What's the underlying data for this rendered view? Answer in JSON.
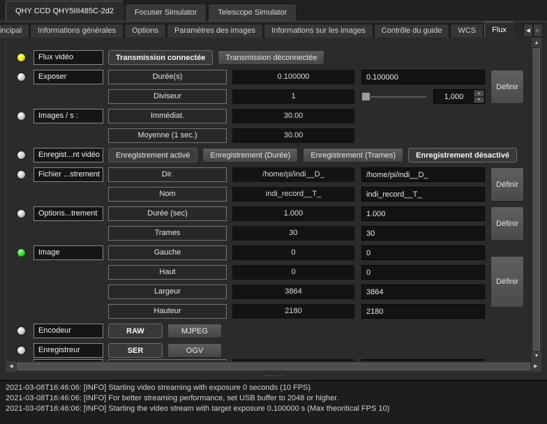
{
  "tabs": {
    "devices": [
      {
        "label": "QHY CCD QHY5III485C-2d2",
        "active": true
      },
      {
        "label": "Focuser Simulator",
        "active": false
      },
      {
        "label": "Telescope Simulator",
        "active": false
      }
    ],
    "groups": [
      {
        "label": "e principal",
        "active": false
      },
      {
        "label": "Informations générales",
        "active": false
      },
      {
        "label": "Options",
        "active": false
      },
      {
        "label": "Paramètres des images",
        "active": false
      },
      {
        "label": "Informations sur les images",
        "active": false
      },
      {
        "label": "Contrôle du guide",
        "active": false
      },
      {
        "label": "WCS",
        "active": false
      },
      {
        "label": "Flux",
        "active": true
      }
    ]
  },
  "icons": {
    "tab_scroll_left": "◀",
    "tab_scroll_right": "▶",
    "scroll_up": "▲",
    "scroll_down": "▼",
    "scroll_left": "◀",
    "scroll_right": "▶",
    "spin_up": "▲",
    "spin_down": "▼",
    "splitter_dots": "······"
  },
  "colors": {
    "led_yellow": "#e6e619",
    "led_green": "#2fd52f",
    "led_idle": "#c9c9c9",
    "background": "#2b2b2b",
    "field_background": "#131313"
  },
  "groups": {
    "video_stream": {
      "led": "yellow",
      "label": "Flux vidéo",
      "on_button": "Transmission connectée",
      "off_button": "Transmission déconnectée"
    },
    "expose": {
      "led": "idle",
      "label": "Exposer",
      "duration": {
        "name": "Durée(s)",
        "value": "0.100000",
        "edit": "0.100000"
      },
      "divisor": {
        "name": "Diviseur",
        "value": "1",
        "spin_value": "1,000"
      },
      "set_button": "Définir"
    },
    "fps": {
      "led": "idle",
      "label": "Images / s :",
      "instant": {
        "name": "Immédiat.",
        "value": "30.00"
      },
      "average": {
        "name": "Moyenne (1 sec.)",
        "value": "30.00"
      }
    },
    "record_stream": {
      "led": "idle",
      "label": "Enregist...nt vidéo",
      "record_on": "Enregistrement activé",
      "record_duration": "Enregistrement (Durée)",
      "record_frames": "Enregistrement (Trames)",
      "record_off": "Enregistrement désactivé"
    },
    "record_file": {
      "led": "idle",
      "label": "Fichier ...strement",
      "dir": {
        "name": "Dir.",
        "value": "/home/pi/indi__D_",
        "edit": "/home/pi/indi__D_"
      },
      "file": {
        "name": "Nom",
        "value": "indi_record__T_",
        "edit": "indi_record__T_"
      },
      "set_button": "Définir"
    },
    "record_options": {
      "led": "idle",
      "label": "Options...trement",
      "duration": {
        "name": "Durée (sec)",
        "value": "1.000",
        "edit": "1.000"
      },
      "frames": {
        "name": "Trames",
        "value": "30",
        "edit": "30"
      },
      "set_button": "Définir"
    },
    "frame": {
      "led": "green",
      "label": "Image",
      "left": {
        "name": "Gauche",
        "value": "0",
        "edit": "0"
      },
      "top": {
        "name": "Haut",
        "value": "0",
        "edit": "0"
      },
      "width": {
        "name": "Largeur",
        "value": "3864",
        "edit": "3864"
      },
      "height": {
        "name": "Hauteur",
        "value": "2180",
        "edit": "2180"
      },
      "set_button": "Définir"
    },
    "encoder": {
      "led": "idle",
      "label": "Encodeur",
      "raw_button": "RAW",
      "mjpeg_button": "MJPEG"
    },
    "recorder": {
      "led": "idle",
      "label": "Enregistreur",
      "ser_button": "SER",
      "ogv_button": "OGV"
    }
  },
  "log": {
    "lines": [
      "2021-03-08T16:46:06: [INFO] Starting video streaming with exposure 0 seconds (10 FPS)",
      "2021-03-08T16:46:06: [INFO] For better streaming performance, set USB buffer to 2048 or higher.",
      "2021-03-08T16:46:06: [INFO] Starting the video stream with target exposure 0.100000 s (Max theoritical FPS 10)"
    ]
  }
}
